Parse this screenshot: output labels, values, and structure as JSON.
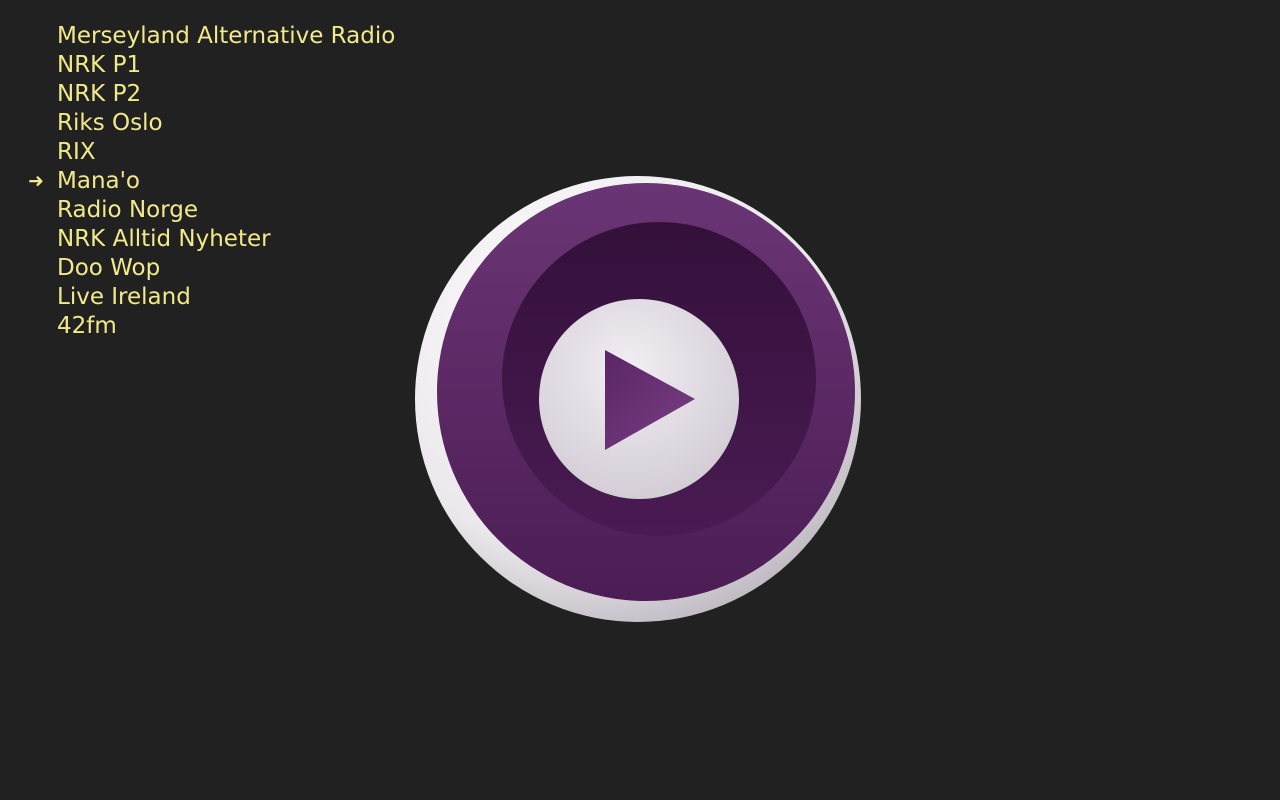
{
  "playlist": {
    "current_index": 5,
    "current_marker": "➜",
    "items": [
      {
        "label": "Merseyland Alternative Radio"
      },
      {
        "label": "NRK P1"
      },
      {
        "label": "NRK P2"
      },
      {
        "label": "Riks Oslo"
      },
      {
        "label": "RIX"
      },
      {
        "label": "Mana'o"
      },
      {
        "label": "Radio Norge"
      },
      {
        "label": "NRK Alltid Nyheter"
      },
      {
        "label": "Doo Wop"
      },
      {
        "label": "Live Ireland"
      },
      {
        "label": "42fm"
      }
    ]
  },
  "player": {
    "logo_icon": "mpv-play-logo-icon"
  },
  "colors": {
    "background": "#212121",
    "playlist_text": "#f1e98a",
    "logo_purple": "#5a2663",
    "logo_inner": "#3c1242",
    "logo_light": "#e6e1e9"
  }
}
